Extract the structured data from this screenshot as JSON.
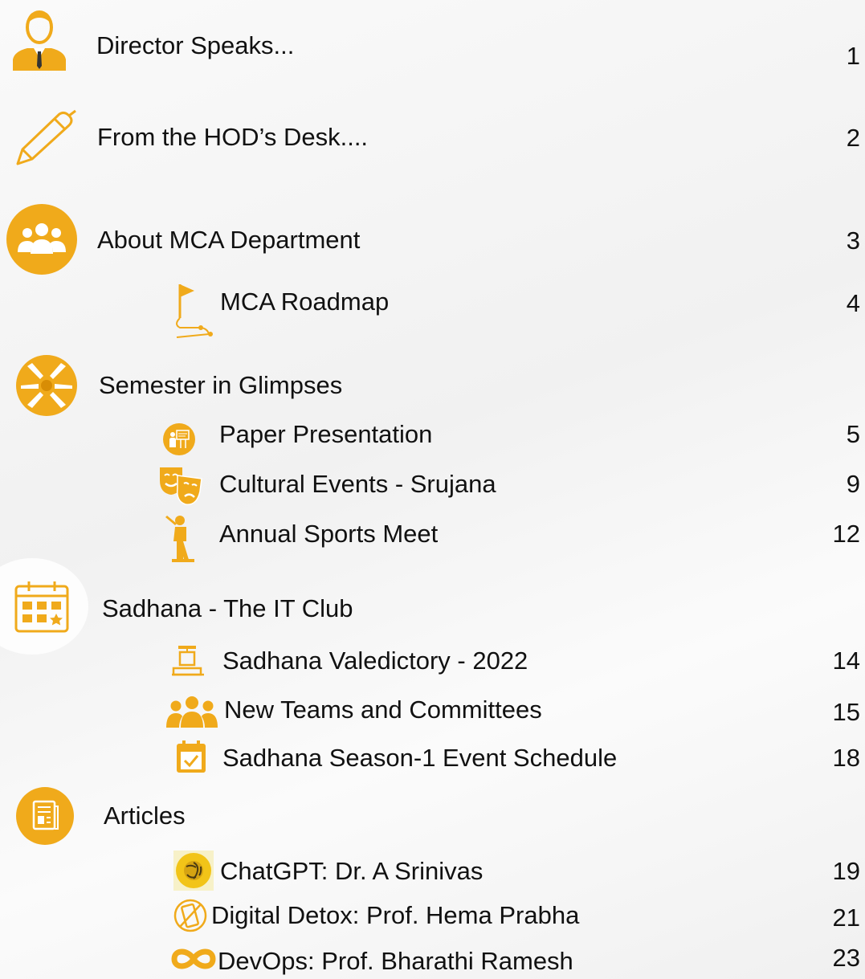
{
  "toc": {
    "director": {
      "label": "Director Speaks...",
      "page": "1"
    },
    "hod": {
      "label": "From the HOD’s Desk....",
      "page": "2"
    },
    "about": {
      "label": "About MCA Department",
      "page": "3"
    },
    "roadmap": {
      "label": "MCA Roadmap",
      "page": "4"
    },
    "glimpses": {
      "label": "Semester in Glimpses"
    },
    "paper": {
      "label": "Paper Presentation",
      "page": "5"
    },
    "cultural": {
      "label": "Cultural Events - Srujana",
      "page": "9"
    },
    "sports": {
      "label": "Annual Sports Meet",
      "page": "12"
    },
    "sadhana": {
      "label": "Sadhana - The IT Club"
    },
    "valedictory": {
      "label": "Sadhana Valedictory - 2022",
      "page": "14"
    },
    "teams": {
      "label": "New Teams and Committees",
      "page": "15"
    },
    "schedule": {
      "label": "Sadhana Season-1 Event Schedule",
      "page": "18"
    },
    "articles": {
      "label": "Articles"
    },
    "chatgpt": {
      "label": "ChatGPT: Dr. A Srinivas",
      "page": "19"
    },
    "detox": {
      "label": "Digital Detox: Prof. Hema Prabha",
      "page": "21"
    },
    "devops": {
      "label": "DevOps: Prof. Bharathi Ramesh",
      "page": "23"
    }
  },
  "icons": {
    "director": "businessman-icon",
    "hod": "pen-icon",
    "about": "group-icon",
    "roadmap": "flag-route-icon",
    "glimpses": "hands-icon",
    "paper": "presentation-icon",
    "cultural": "theatre-masks-icon",
    "sports": "cricket-player-icon",
    "sadhana": "calendar-grid-icon",
    "valedictory": "podium-icon",
    "teams": "team-icon",
    "schedule": "calendar-check-icon",
    "articles": "document-icon",
    "chatgpt": "chatgpt-logo-icon",
    "detox": "no-phone-icon",
    "devops": "infinity-icon"
  },
  "colors": {
    "accent": "#F0AA1B",
    "text": "#111111"
  }
}
